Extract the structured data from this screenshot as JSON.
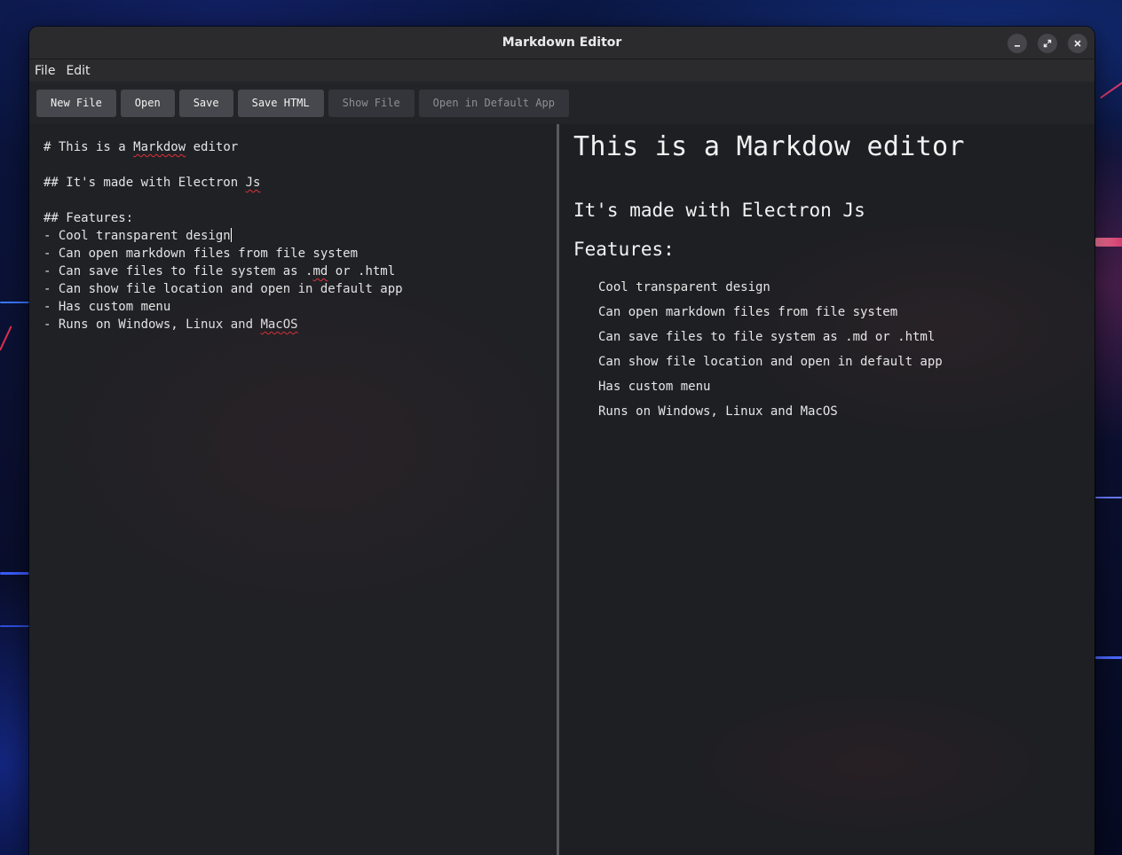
{
  "window": {
    "title": "Markdown Editor"
  },
  "menu": {
    "items": [
      "File",
      "Edit"
    ]
  },
  "toolbar": {
    "buttons": [
      {
        "label": "New File",
        "enabled": true
      },
      {
        "label": "Open",
        "enabled": true
      },
      {
        "label": "Save",
        "enabled": true
      },
      {
        "label": "Save HTML",
        "enabled": true
      },
      {
        "label": "Show File",
        "enabled": false
      },
      {
        "label": "Open in Default App",
        "enabled": false
      }
    ]
  },
  "editor": {
    "lines": [
      "# This is a Markdow editor",
      "",
      "## It's made with Electron Js",
      "",
      "## Features:",
      "- Cool transparent design",
      "- Can open markdown files from file system",
      "- Can save files to file system as .md or .html",
      "- Can show file location and open in default app",
      "- Has custom menu",
      "- Runs on Windows, Linux and MacOS"
    ]
  },
  "preview": {
    "h1": "This is a Markdow editor",
    "h2_first": "It's made with Electron Js",
    "h2_second": "Features:",
    "list": [
      "Cool transparent design",
      "Can open markdown files from file system",
      "Can save files to file system as .md or .html",
      "Can show file location and open in default app",
      "Has custom menu",
      "Runs on Windows, Linux and MacOS"
    ]
  },
  "icons": {
    "minimize": "minimize-icon",
    "maximize": "maximize-icon",
    "close": "close-icon"
  },
  "colors": {
    "window_bg": "#1f2024",
    "titlebar_bg": "#2b2b2e",
    "button_bg": "#47484d",
    "button_disabled_bg": "#34353a",
    "spellcheck": "#e0303a"
  }
}
